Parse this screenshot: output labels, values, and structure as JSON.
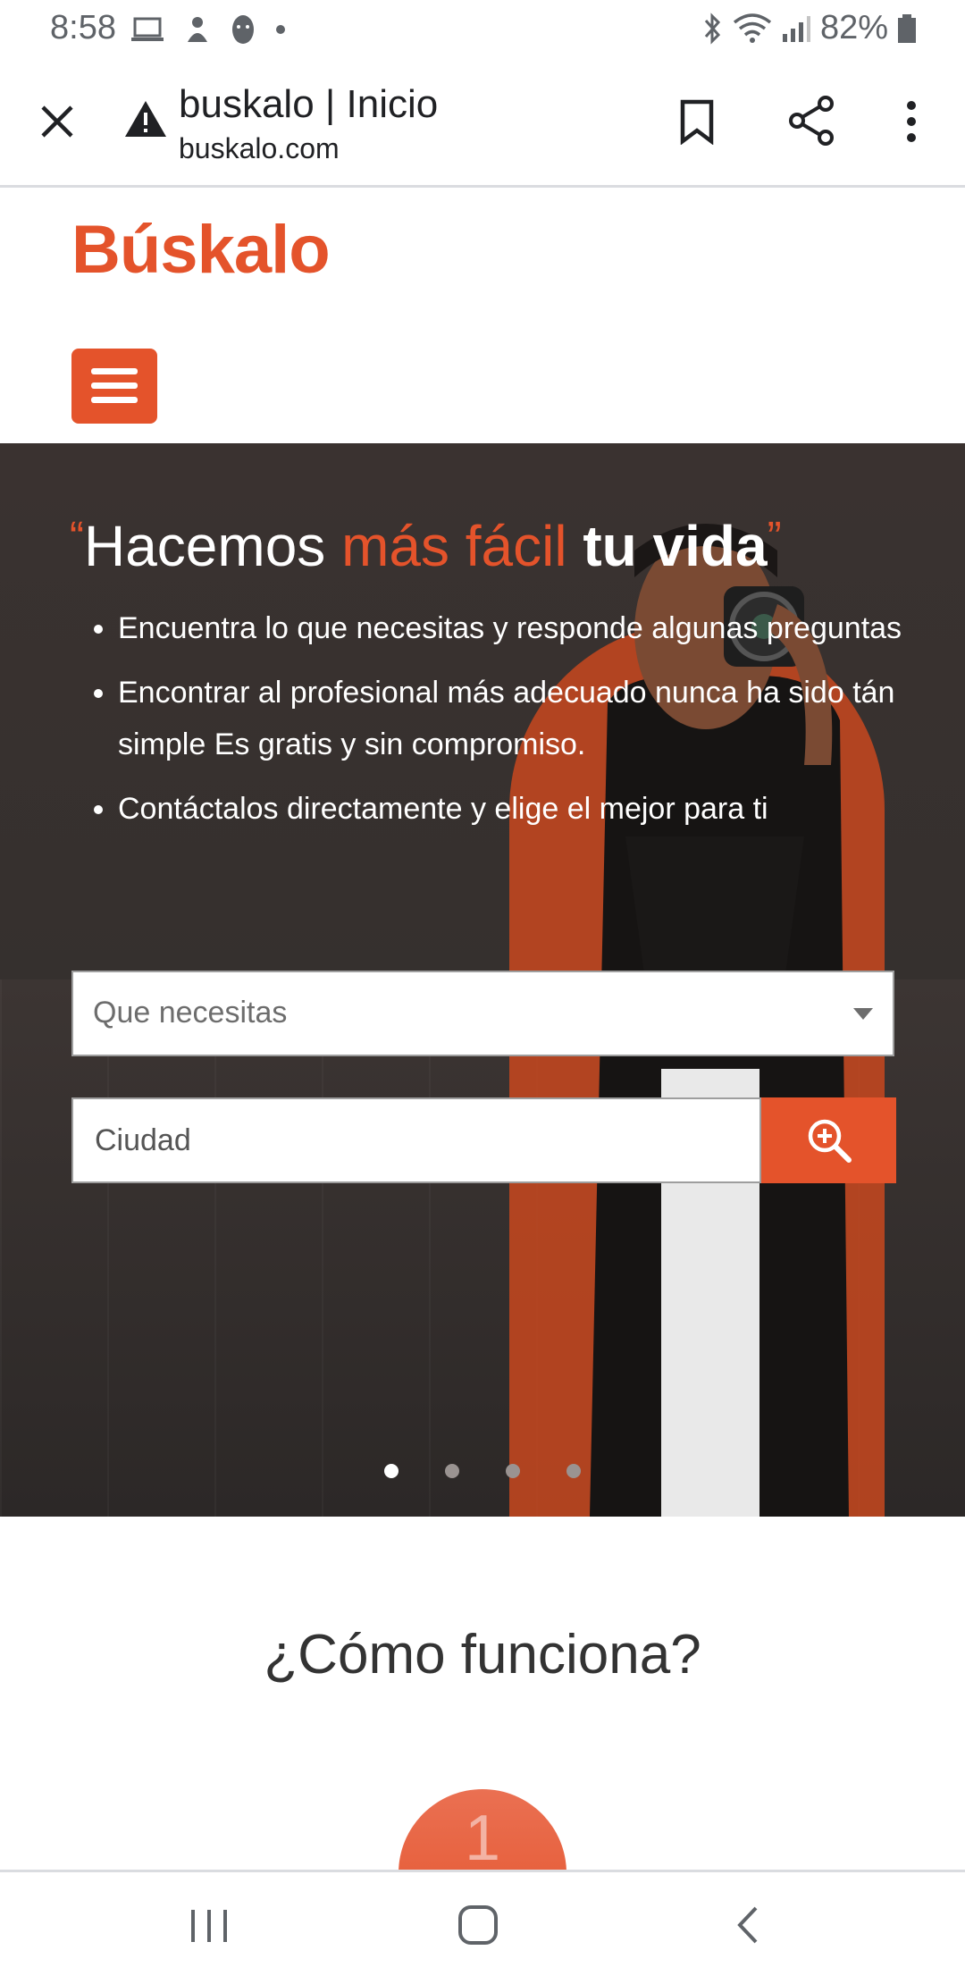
{
  "status_bar": {
    "time": "8:58",
    "battery": "82%"
  },
  "tab": {
    "title": "buskalo | Inicio",
    "url": "buskalo.com"
  },
  "site": {
    "logo": "Búskalo",
    "brand_color": "#e4532b"
  },
  "hero": {
    "heading": {
      "open_quote": "“",
      "part1": "Hacemos ",
      "part2": "más fácil",
      "part3": " tu vida",
      "close_quote": "”"
    },
    "bullets": [
      "Encuentra lo que necesitas y responde algunas preguntas",
      "Encontrar al profesional más adecuado nunca ha sido tán simple Es gratis y sin compromiso.",
      "Contáctalos directamente y elige el mejor para ti"
    ],
    "need_select": "Que necesitas",
    "city_placeholder": "Ciudad",
    "carousel_active": 1,
    "carousel_total": 4
  },
  "how": {
    "title": "¿Cómo funciona?",
    "step_number": "1"
  },
  "icons": [
    "close-icon",
    "warning-icon",
    "bookmark-icon",
    "share-icon",
    "more-vert-icon",
    "menu-icon",
    "search-plus-icon",
    "recents-icon",
    "home-icon",
    "back-icon"
  ]
}
